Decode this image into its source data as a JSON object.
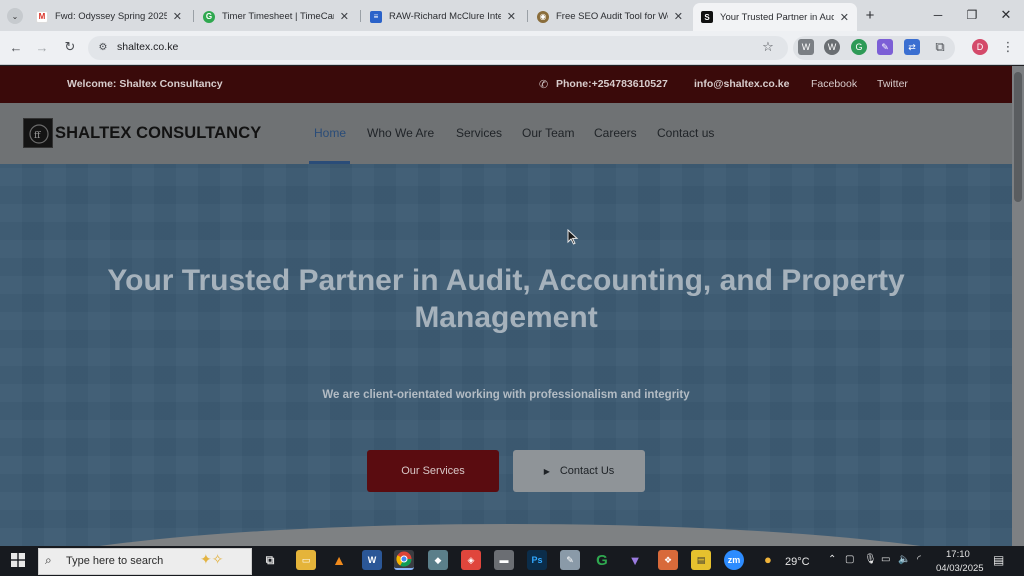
{
  "browser": {
    "tabs": [
      {
        "title": "Fwd: Odyssey Spring 2025 |",
        "icon": "gmail-icon",
        "color": "#d93025",
        "glyph": "M"
      },
      {
        "title": "Timer Timesheet | TimeCam",
        "icon": "timecamp-icon",
        "color": "#2fa84f",
        "glyph": "G"
      },
      {
        "title": "RAW-Richard McClure Interv",
        "icon": "google-docs-icon",
        "color": "#2a62c9",
        "glyph": "≡"
      },
      {
        "title": "Free SEO Audit Tool for We",
        "icon": "seo-tool-icon",
        "color": "#8a6d3b",
        "glyph": "◉"
      },
      {
        "title": "Your Trusted Partner in Audi",
        "icon": "shaltex-favicon",
        "color": "#111111",
        "glyph": "S"
      }
    ],
    "url": "shaltex.co.ke",
    "profile_initial": "D"
  },
  "site": {
    "topbar": {
      "welcome": "Welcome: Shaltex Consultancy",
      "phone": "Phone:+254783610527",
      "email": "info@shaltex.co.ke",
      "facebook": "Facebook",
      "twitter": "Twitter"
    },
    "logo_text": "SHALTEX CONSULTANCY",
    "nav": [
      "Home",
      "Who We Are",
      "Services",
      "Our Team",
      "Careers",
      "Contact us"
    ],
    "active_nav": "Home",
    "hero": {
      "title": "Your Trusted Partner in Audit, Accounting, and Property Management",
      "subtitle": "We are client-orientated working with professionalism and integrity",
      "primary_button": "Our Services",
      "secondary_button": "Contact Us"
    }
  },
  "taskbar": {
    "search_placeholder": "Type here to search",
    "weather": "29°C",
    "time": "17:10",
    "date": "04/03/2025"
  }
}
